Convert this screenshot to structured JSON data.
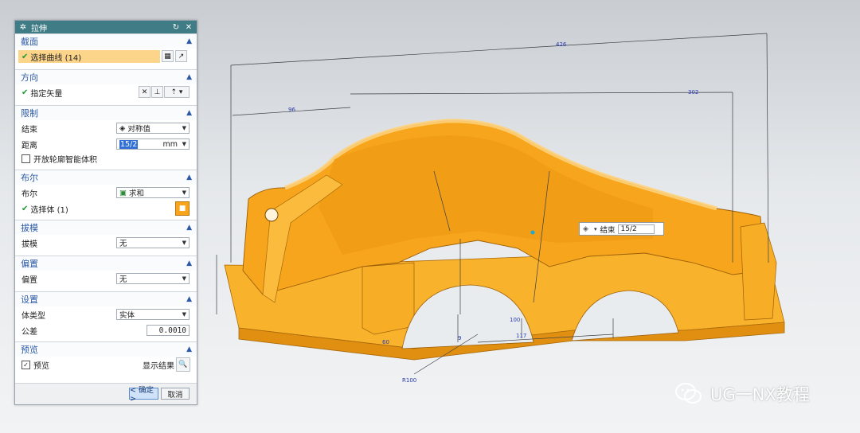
{
  "dialog": {
    "title": "拉伸",
    "sections": {
      "section": {
        "title": "截面",
        "select_curve": "选择曲线 (14)"
      },
      "direction": {
        "title": "方向",
        "specify_vector": "指定矢量"
      },
      "limits": {
        "title": "限制",
        "end_label": "结束",
        "end_value": "对称值",
        "distance_label": "距离",
        "distance_value": "15/2",
        "distance_unit": "mm",
        "open_profile": "开放轮廓智能体积"
      },
      "boolean": {
        "title": "布尔",
        "boolean_label": "布尔",
        "boolean_value": "求和",
        "select_body": "选择体 (1)"
      },
      "draft": {
        "title": "拔模",
        "draft_label": "拔模",
        "draft_value": "无"
      },
      "offset": {
        "title": "偏置",
        "offset_label": "偏置",
        "offset_value": "无"
      },
      "settings": {
        "title": "设置",
        "body_type_label": "体类型",
        "body_type_value": "实体",
        "tolerance_label": "公差",
        "tolerance_value": "0.0010"
      },
      "preview": {
        "title": "预览",
        "preview_label": "预览",
        "show_result": "显示结果"
      }
    },
    "ok_label": "< 确定 >",
    "cancel_label": "取消"
  },
  "limit_widget": {
    "label": "结束",
    "value": "15/2"
  },
  "dimensions": {
    "overall": "426",
    "d96": "96",
    "d302": "302",
    "d100": "100",
    "d117": "117",
    "d9": "9",
    "r100": "R100",
    "d60": "60"
  },
  "watermark": "UG一NX教程",
  "colors": {
    "part_face": "#f7a81b",
    "part_shade": "#d98a10",
    "part_top": "#fbc03e",
    "title_bar": "#3f7c86",
    "section_title": "#2c5aa6",
    "highlight": "#fcd58a",
    "check": "#1f9a31"
  },
  "icons": [
    "gear-icon",
    "reset-icon",
    "close-icon",
    "chevron-up-icon",
    "check-icon",
    "curve-select-icon",
    "sketch-icon",
    "vector-flip-icon",
    "vector-icon",
    "body-icon",
    "magnifier-icon",
    "wechat-icon"
  ]
}
